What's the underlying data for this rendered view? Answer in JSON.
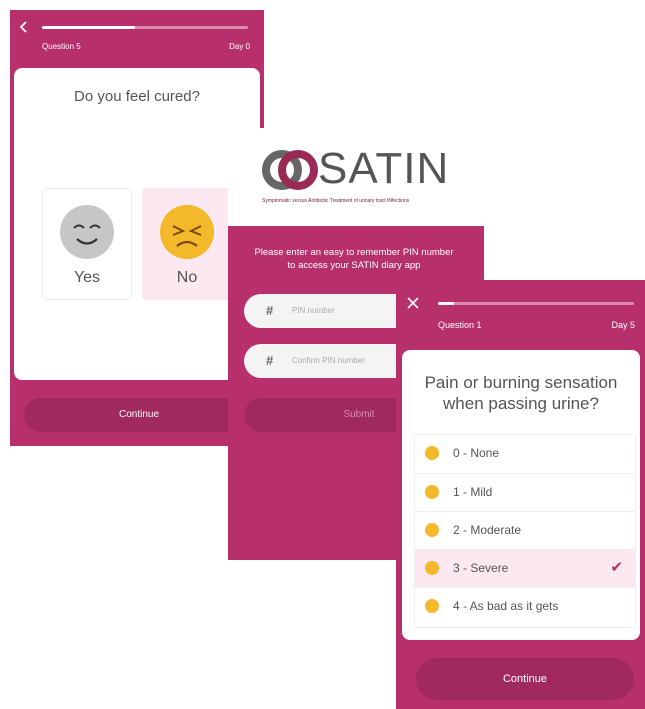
{
  "colors": {
    "brand": "#b8306b",
    "button": "#a02a5f",
    "selected_bg": "#fbe8f0",
    "emoji_yellow": "#f3b92a"
  },
  "screen1": {
    "back_icon": "chevron-left-icon",
    "progress": 0.45,
    "question_number": "Question 5",
    "day": "Day 0",
    "question": "Do you feel cured?",
    "choices": [
      {
        "label": "Yes",
        "icon": "smiling-face-icon",
        "selected": false
      },
      {
        "label": "No",
        "icon": "sad-face-icon",
        "selected": true
      }
    ],
    "continue_label": "Continue"
  },
  "screen2": {
    "logo_text": "SATIN",
    "tagline": "Symptomatic versus Antibiotic Treatment of urinary tract INfections",
    "prompt": "Please enter an easy to remember PIN number to access your SATIN diary app",
    "pin_placeholder": "PIN number",
    "confirm_placeholder": "Confirm PIN number",
    "submit_label": "Submit"
  },
  "screen3": {
    "close_icon": "close-icon",
    "progress": 0.08,
    "question_number": "Question 1",
    "day": "Day 5",
    "question": "Pain or burning sensation when passing urine?",
    "options": [
      {
        "label": "0 - None",
        "selected": false
      },
      {
        "label": "1 - Mild",
        "selected": false
      },
      {
        "label": "2 - Moderate",
        "selected": false
      },
      {
        "label": "3 - Severe",
        "selected": true
      },
      {
        "label": "4 - As bad as it gets",
        "selected": false
      }
    ],
    "check_icon": "checkmark-icon",
    "continue_label": "Continue"
  }
}
